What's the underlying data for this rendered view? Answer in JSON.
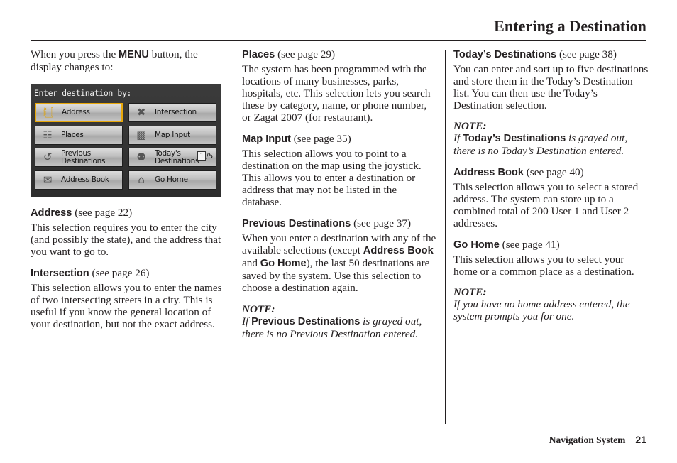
{
  "header": {
    "title": "Entering a Destination"
  },
  "intro": {
    "before": "When you press the ",
    "button": "MENU",
    "after": " button, the display changes to:"
  },
  "nav_screen": {
    "title": "Enter destination by:",
    "selected_color": "#e8a80a",
    "buttons": [
      {
        "label": "Address",
        "icon": "notepad-icon",
        "selected": true
      },
      {
        "label": "Intersection",
        "icon": "intersection-icon"
      },
      {
        "label": "Places",
        "icon": "places-icon"
      },
      {
        "label": "Map Input",
        "icon": "us-map-icon"
      },
      {
        "label_line1": "Previous",
        "label_line2": "Destinations",
        "icon": "previous-destinations-icon"
      },
      {
        "label_line1": "Today's",
        "label_line2": "Destinations",
        "icon": "todays-destinations-icon",
        "counter_current": "1",
        "counter_total": "/5"
      },
      {
        "label": "Address Book",
        "icon": "address-book-icon"
      },
      {
        "label": "Go Home",
        "icon": "home-icon"
      }
    ]
  },
  "sections": {
    "address": {
      "title": "Address",
      "ref": "(see page 22)",
      "body": "This selection requires you to enter the city (and possibly the state), and the address that you want to go to."
    },
    "intersection": {
      "title": "Intersection",
      "ref": "(see page 26)",
      "body": "This selection allows you to enter the names of two intersecting streets in a city. This is useful if you know the general location of your destination, but not the exact address."
    },
    "places": {
      "title": "Places",
      "ref": "(see page 29)",
      "body": "The system has been programmed with the locations of many businesses, parks, hospitals, etc. This selection lets you search these by category, name, or phone number, or Zagat 2007 (for restaurant)."
    },
    "map_input": {
      "title": "Map Input",
      "ref": "(see page 35)",
      "body": "This selection allows you to point to a destination on the map using the joystick. This allows you to enter a destination or address that may not be listed in the database."
    },
    "previous": {
      "title": "Previous Destinations",
      "ref": "(see page 37)",
      "body_1": "When you enter a destination with any of the available selections (except ",
      "bold_1": "Address Book",
      "body_2": " and ",
      "bold_2": "Go Home",
      "body_3": "), the last 50 destinations are saved by the system. Use this selection to choose a destination again.",
      "note_label": "NOTE:",
      "note_if": "If ",
      "note_bold": "Previous Destinations",
      "note_rest": " is grayed out, there is no Previous Destination entered."
    },
    "todays": {
      "title": "Today’s Destinations",
      "ref": "(see page 38)",
      "body": "You can enter and sort up to five destinations and store them in the Today’s Destination list. You can then use the Today’s Destination selection.",
      "note_label": "NOTE:",
      "note_if": "If ",
      "note_bold": "Today’s Destinations",
      "note_rest": " is grayed out, there is no Today’s Destination entered."
    },
    "address_book": {
      "title": "Address Book",
      "ref": "(see page 40)",
      "body": "This selection allows you to select a stored address. The system can store up to a combined total of  200 User 1 and User 2 addresses."
    },
    "go_home": {
      "title": "Go Home",
      "ref": "(see page 41)",
      "body": "This selection allows you to select your home or a common place as a destination.",
      "note_label": "NOTE:",
      "note_text": "If you have no home address entered, the system prompts you for one."
    }
  },
  "footer": {
    "label": "Navigation System",
    "page": "21"
  }
}
